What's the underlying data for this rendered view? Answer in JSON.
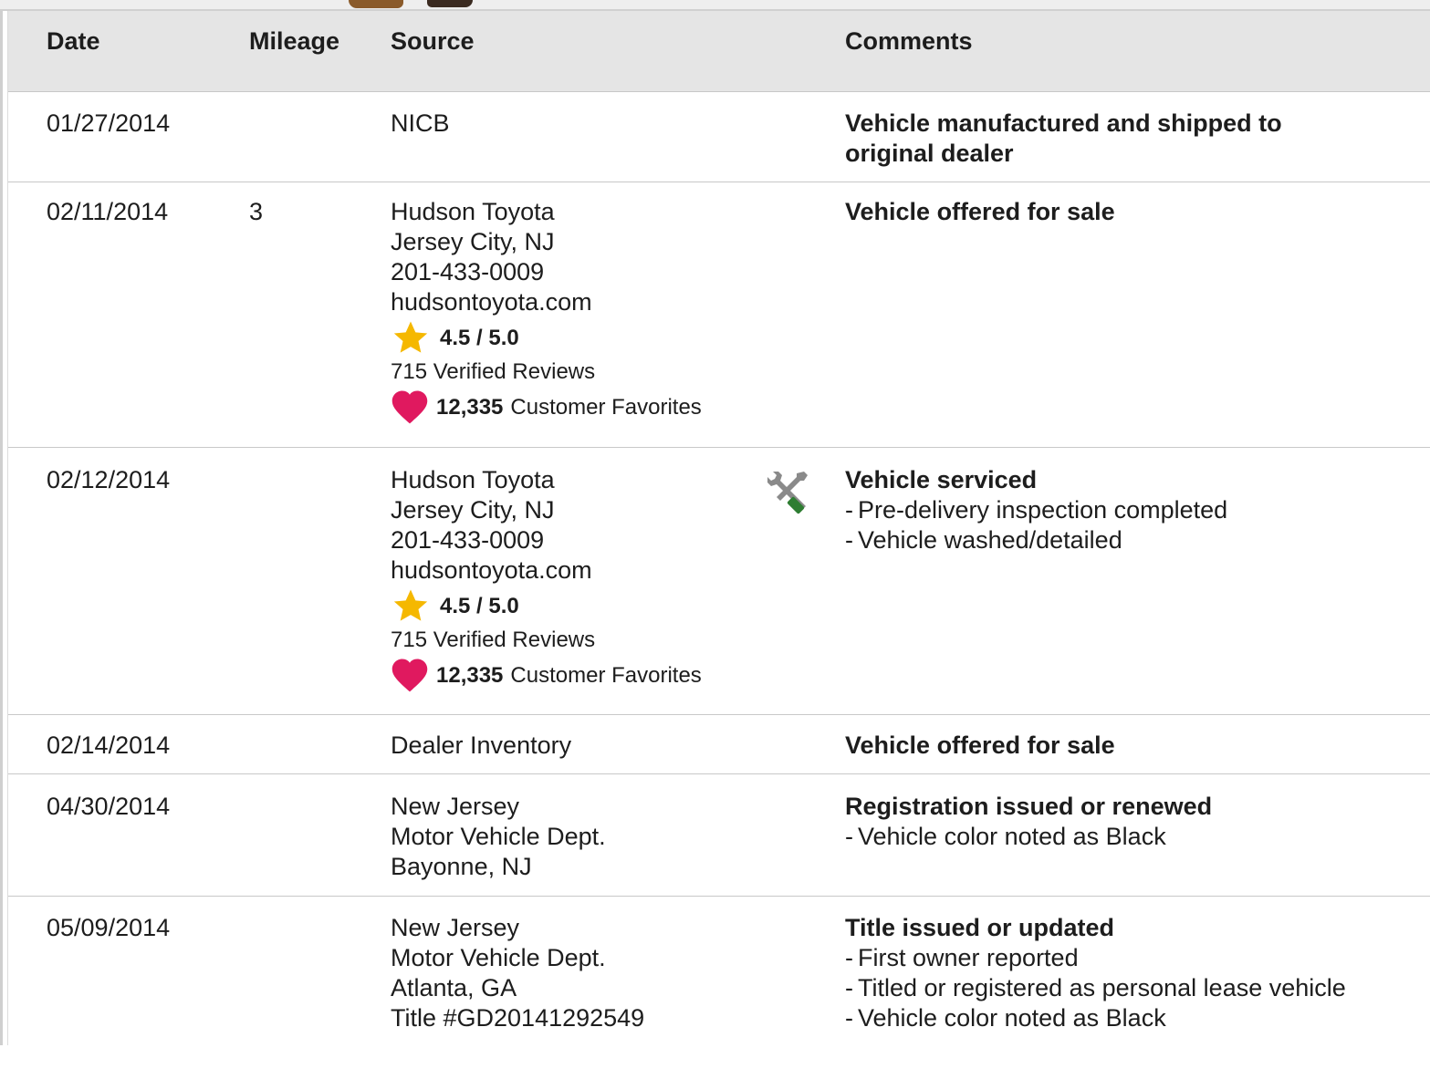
{
  "colors": {
    "header_bg": "#e5e5e5",
    "star": "#f5b800",
    "heart": "#e0195f",
    "wrench_green": "#2e7d32",
    "tool_gray": "#8a8a8a"
  },
  "headers": {
    "date": "Date",
    "mileage": "Mileage",
    "source": "Source",
    "comments": "Comments"
  },
  "dealer": {
    "rating": "4.5 / 5.0",
    "reviews": "715 Verified Reviews",
    "favorites_count": "12,335",
    "favorites_label": "Customer Favorites"
  },
  "icons": {
    "rating": "star-icon",
    "favorites": "heart-icon",
    "service": "wrench-screwdriver-icon"
  },
  "rows": [
    {
      "date": "01/27/2014",
      "mileage": "",
      "source": [
        "NICB"
      ],
      "comment_title": "Vehicle manufactured and shipped to original dealer",
      "details": []
    },
    {
      "date": "02/11/2014",
      "mileage": "3",
      "source": [
        "Hudson Toyota",
        "Jersey City, NJ",
        "201-433-0009",
        "hudsontoyota.com"
      ],
      "comment_title": "Vehicle offered for sale",
      "details": []
    },
    {
      "date": "02/12/2014",
      "mileage": "",
      "source": [
        "Hudson Toyota",
        "Jersey City, NJ",
        "201-433-0009",
        "hudsontoyota.com"
      ],
      "comment_title": "Vehicle serviced",
      "details": [
        "Pre-delivery inspection completed",
        "Vehicle washed/detailed"
      ]
    },
    {
      "date": "02/14/2014",
      "mileage": "",
      "source": [
        "Dealer Inventory"
      ],
      "comment_title": "Vehicle offered for sale",
      "details": []
    },
    {
      "date": "04/30/2014",
      "mileage": "",
      "source": [
        "New Jersey",
        "Motor Vehicle Dept.",
        "Bayonne, NJ"
      ],
      "comment_title": "Registration issued or renewed",
      "details": [
        "Vehicle color noted as Black"
      ]
    },
    {
      "date": "05/09/2014",
      "mileage": "",
      "source": [
        "New Jersey",
        "Motor Vehicle Dept.",
        "Atlanta, GA",
        "Title #GD20141292549"
      ],
      "comment_title": "Title issued or updated",
      "details": [
        "First owner reported",
        "Titled or registered as personal lease vehicle",
        "Vehicle color noted as Black"
      ]
    }
  ]
}
